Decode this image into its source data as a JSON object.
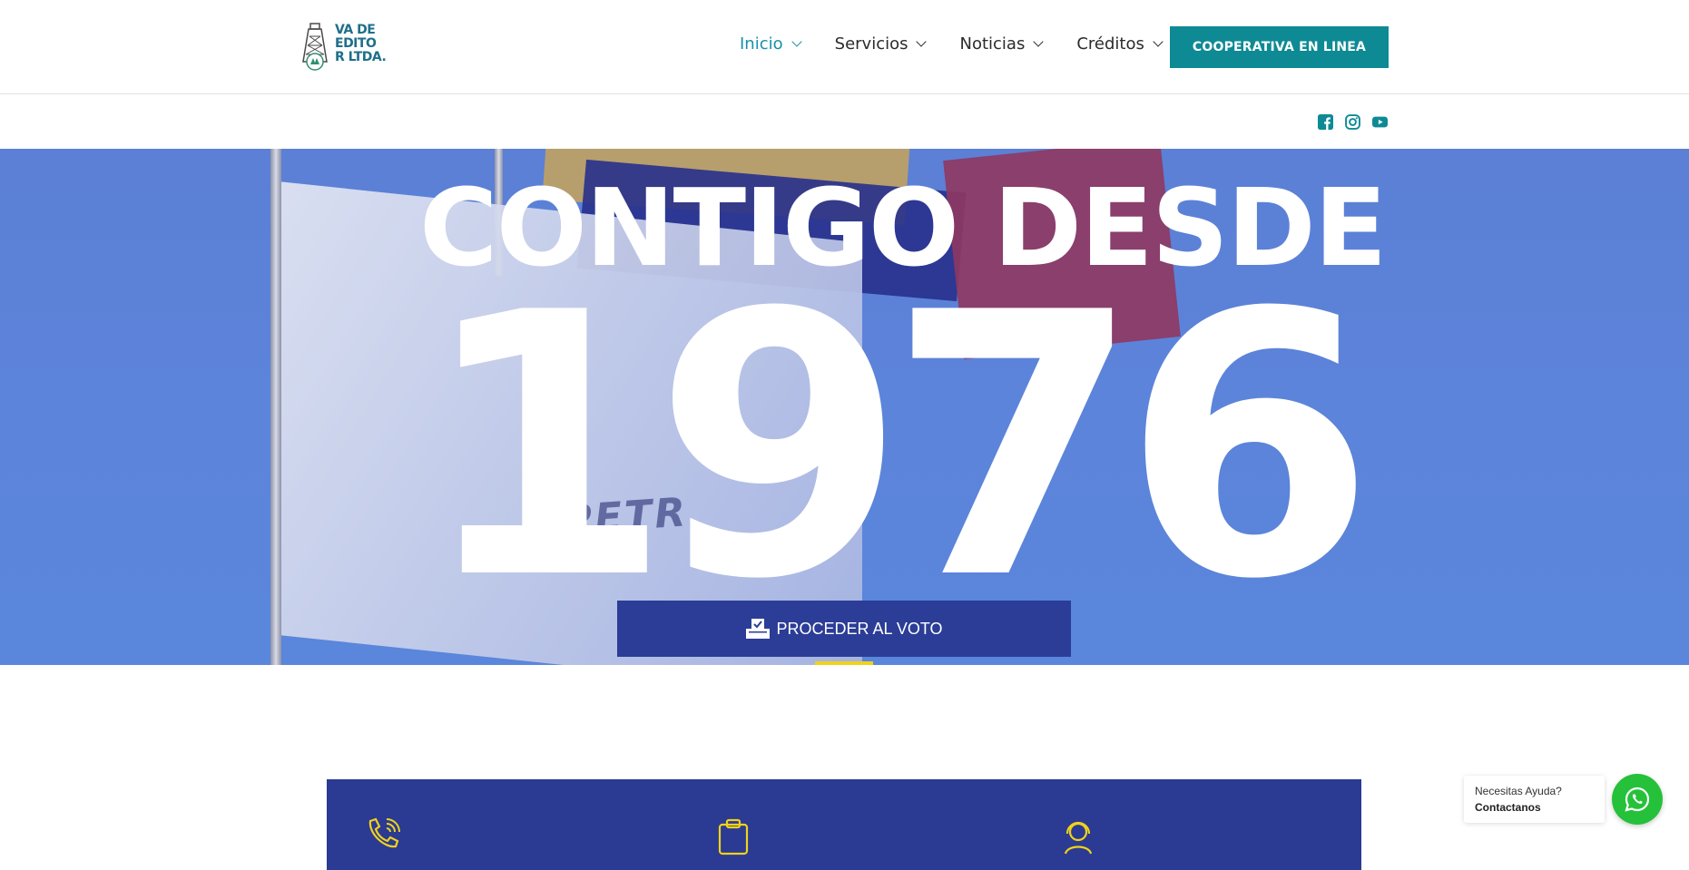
{
  "header": {
    "logo_text": "VA DE\nEDITO\nR LTDA.",
    "nav": [
      {
        "label": "Inicio",
        "active": true
      },
      {
        "label": "Servicios",
        "active": false
      },
      {
        "label": "Noticias",
        "active": false
      },
      {
        "label": "Créditos",
        "active": false
      }
    ],
    "cta_label": "COOPERATIVA EN LINEA",
    "accent_color": "#0e8a95",
    "active_color": "#1591a8"
  },
  "social": {
    "icons": [
      "facebook-icon",
      "instagram-icon",
      "youtube-icon"
    ]
  },
  "hero": {
    "title": "CONTIGO DESDE",
    "year": "1976",
    "flag_text": "PETR",
    "vote_label": "PROCEDER AL VOTO",
    "vote_icon": "ballot-box-icon"
  },
  "info_bar": {
    "icons": [
      "phone-icon",
      "clipboard-icon",
      "support-agent-icon"
    ],
    "color": "#2b3a92"
  },
  "help": {
    "question": "Necesitas Ayuda?",
    "contact": "Contactanos",
    "whatsapp_icon": "whatsapp-icon",
    "whatsapp_color": "#25c13a"
  }
}
